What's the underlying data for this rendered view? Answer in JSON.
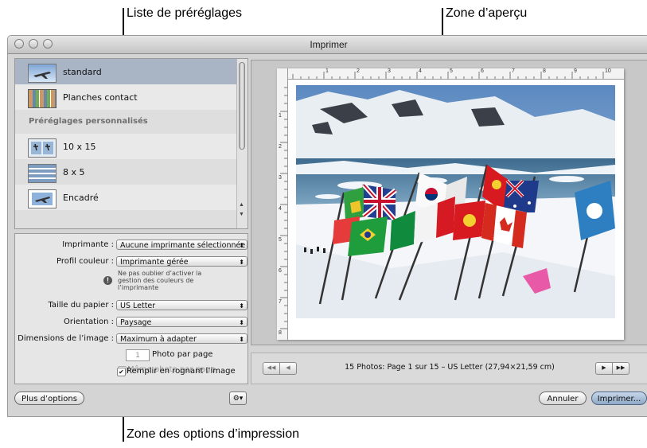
{
  "callouts": {
    "presets_list": "Liste de préréglages",
    "preview_area": "Zone d’aperçu",
    "print_options_area": "Zone des options d’impression"
  },
  "window": {
    "title": "Imprimer"
  },
  "presets": {
    "items": [
      {
        "label": "standard",
        "icon": "jet-photo-thumbnail",
        "selected": true
      },
      {
        "label": "Planches contact",
        "icon": "contact-sheet-thumbnail"
      }
    ],
    "custom_header": "Préréglages personnalisés",
    "custom_items": [
      {
        "label": "10 x 15",
        "icon": "two-up-thumbnail"
      },
      {
        "label": "8 x 5",
        "icon": "grid-thumbnail"
      },
      {
        "label": "Encadré",
        "icon": "framed-photo-thumbnail"
      }
    ]
  },
  "options": {
    "printer_label": "Imprimante :",
    "printer_value": "Aucune imprimante sélectionnée",
    "color_profile_label": "Profil couleur :",
    "color_profile_value": "Imprimante gérée",
    "color_note": "Ne pas oublier d’activer la gestion des couleurs de l’imprimante",
    "paper_size_label": "Taille du papier :",
    "paper_size_value": "US Letter",
    "orientation_label": "Orientation :",
    "orientation_value": "Paysage",
    "image_dimensions_label": "Dimensions de l’image :",
    "image_dimensions_value": "Maximum à adapter",
    "photos_per_page_value": "1",
    "photos_per_page_label": "Photo par page",
    "same_photo_label": "Même photo par page",
    "same_photo_checked": false,
    "fill_crop_label": "Remplir en rognant l’image",
    "fill_crop_checked": true
  },
  "buttons": {
    "more_options": "Plus d’options",
    "cancel": "Annuler",
    "print": "Imprimer..."
  },
  "preview": {
    "ruler_h": [
      "1",
      "2",
      "3",
      "4",
      "5",
      "6",
      "7",
      "8",
      "9",
      "10"
    ],
    "ruler_v": [
      "1",
      "2",
      "3",
      "4",
      "5",
      "6",
      "7",
      "8"
    ]
  },
  "navigation": {
    "status": "15 Photos: Page 1 sur 15 – US Letter (27,94×21,59 cm)",
    "first_icon": "double-left-arrow-icon",
    "prev_icon": "left-arrow-icon",
    "next_icon": "right-arrow-icon",
    "last_icon": "double-right-arrow-icon"
  }
}
